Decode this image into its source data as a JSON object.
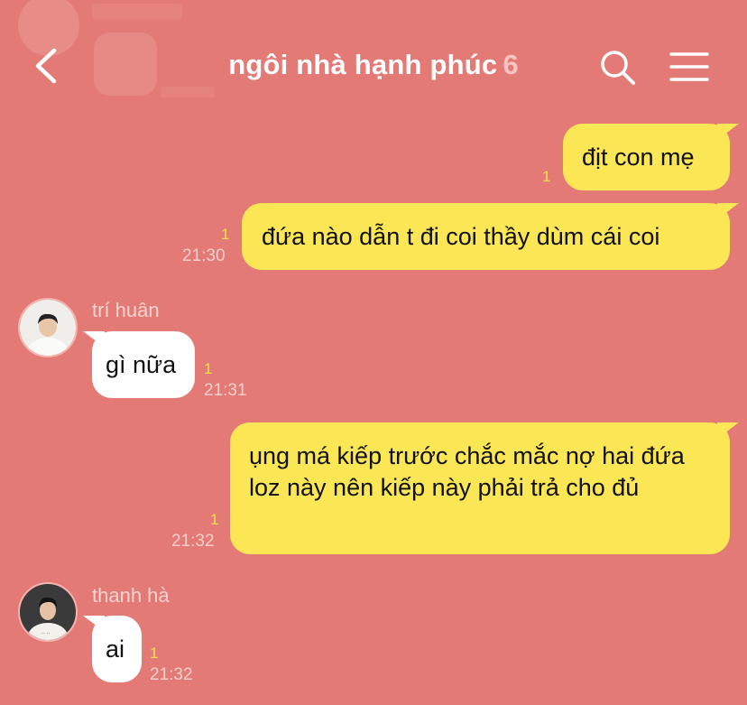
{
  "header": {
    "title": "ngôi nhà hạnh phúc",
    "member_count": "6",
    "back_icon": "chevron-left-icon",
    "search_icon": "search-icon",
    "menu_icon": "hamburger-menu-icon"
  },
  "colors": {
    "background": "#e47a76",
    "my_bubble": "#fbe655",
    "other_bubble": "#ffffff",
    "unread": "#f7e04c",
    "count": "#f7c4c1"
  },
  "messages": [
    {
      "from": "me",
      "text": "địt con mẹ",
      "unread": "1",
      "time": ""
    },
    {
      "from": "me",
      "text": "đứa nào dẫn t đi coi thầy dùm cái coi",
      "unread": "1",
      "time": "21:30"
    },
    {
      "from": "trí huân",
      "text": "gì nữa",
      "unread": "1",
      "time": "21:31"
    },
    {
      "from": "me",
      "text": "ụng má kiếp trước chắc mắc nợ hai đứa loz này nên kiếp này phải trả cho đủ",
      "unread": "1",
      "time": "21:32"
    },
    {
      "from": "thanh hà",
      "text": "ai",
      "unread": "1",
      "time": "21:32"
    }
  ]
}
